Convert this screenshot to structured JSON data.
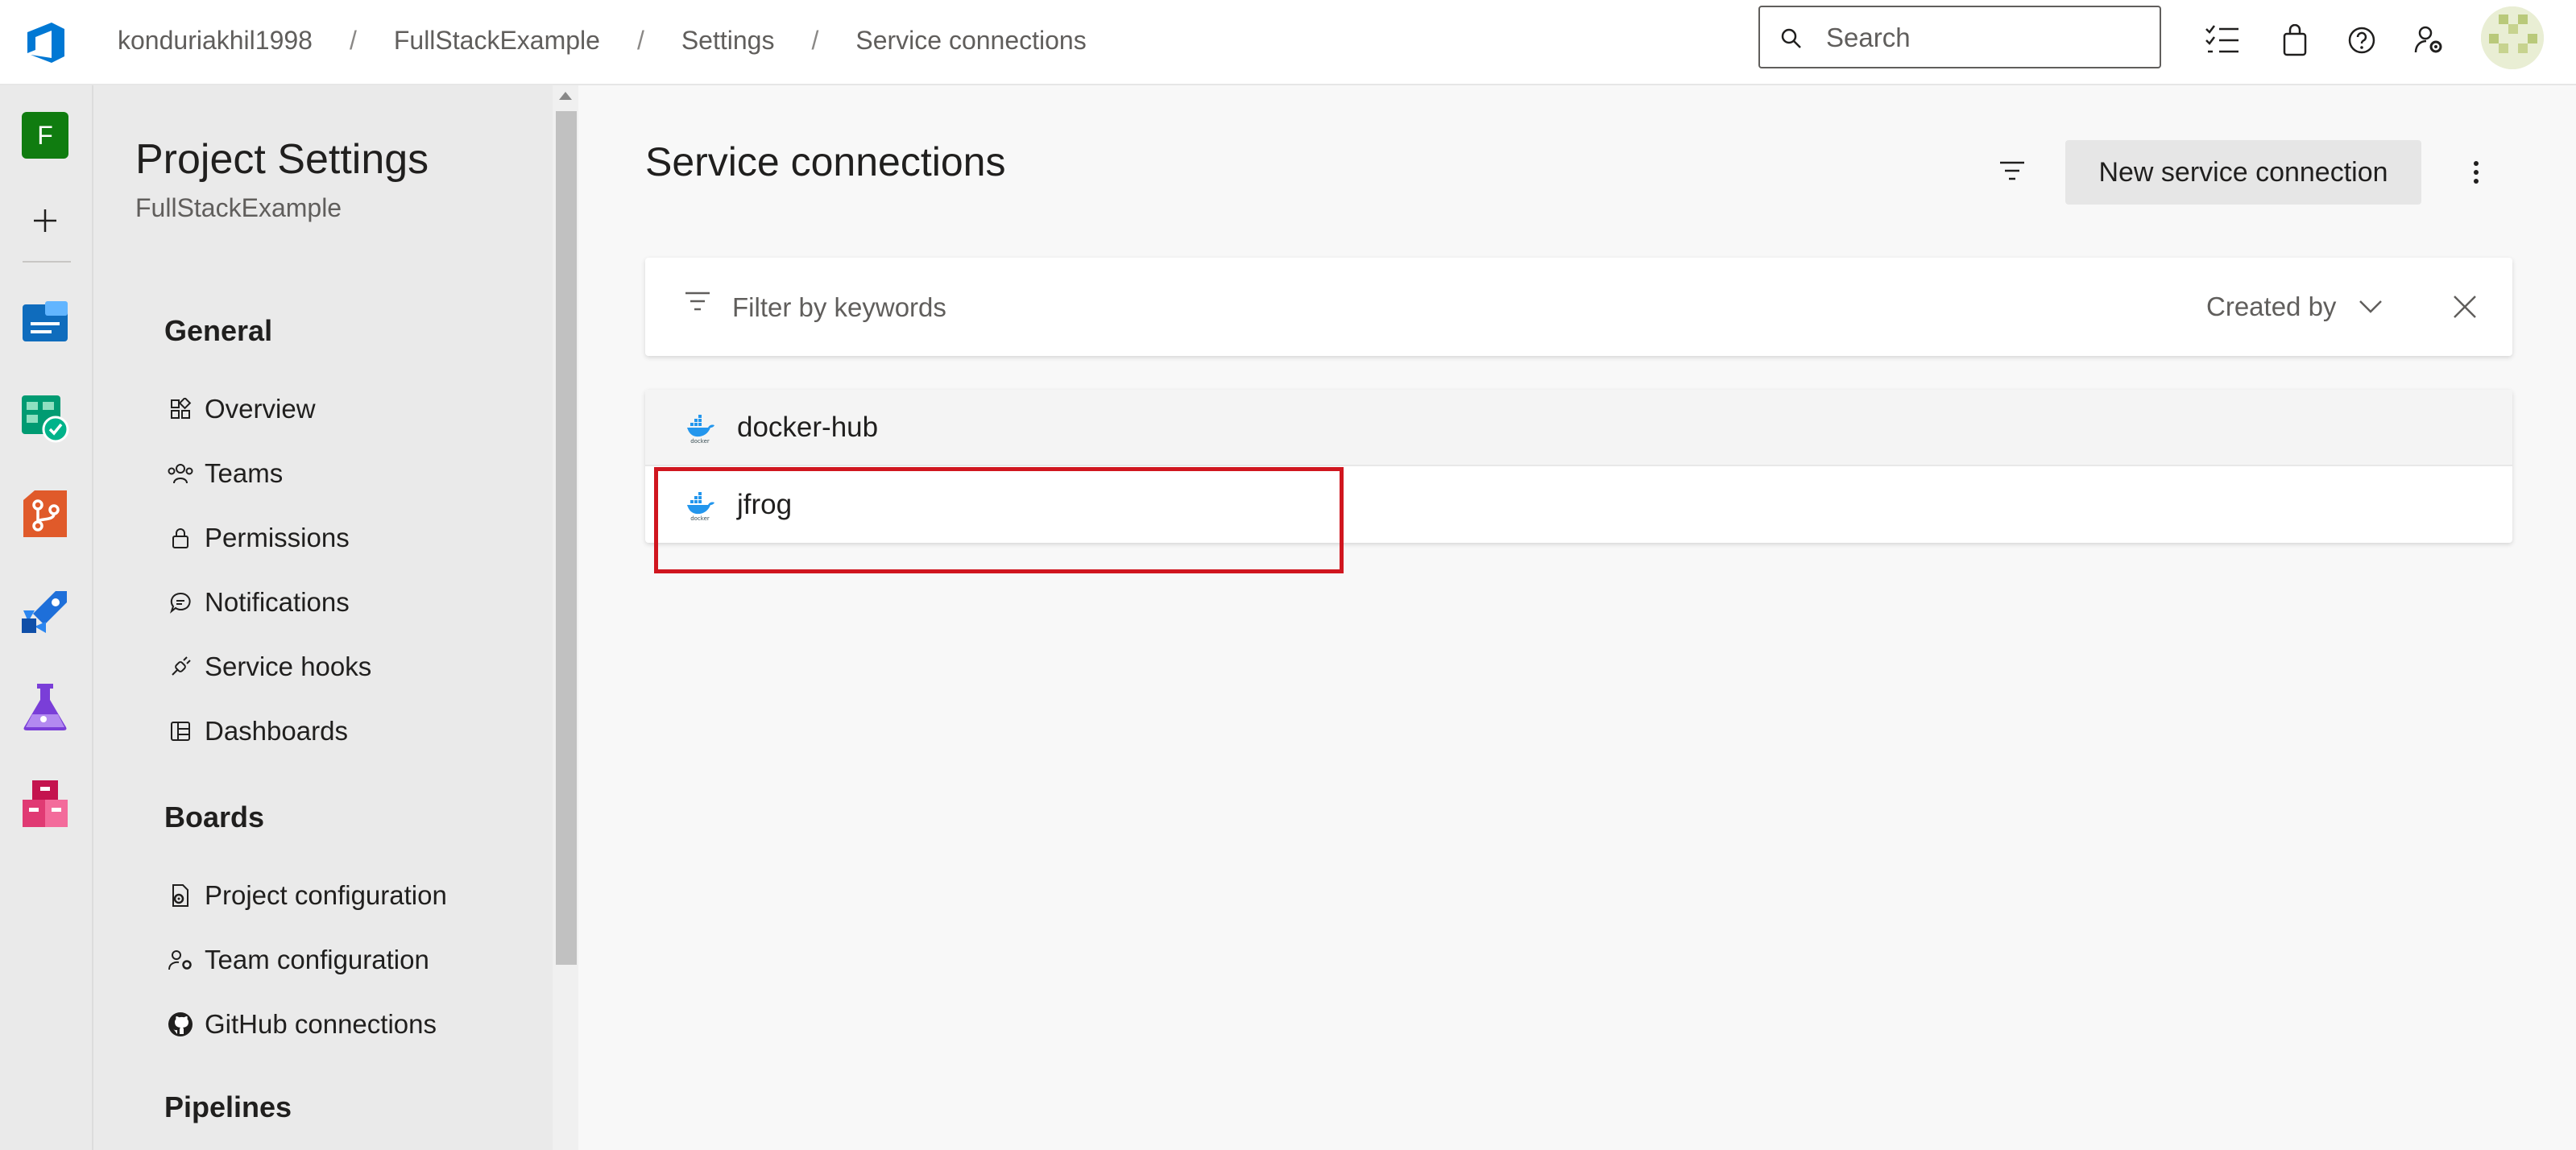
{
  "header": {
    "breadcrumbs": [
      "konduriakhil1998",
      "FullStackExample",
      "Settings",
      "Service connections"
    ],
    "search_placeholder": "Search"
  },
  "rail": {
    "project_initial": "F"
  },
  "settings_nav": {
    "title": "Project Settings",
    "subtitle": "FullStackExample",
    "groups": {
      "general": "General",
      "boards": "Boards",
      "pipelines": "Pipelines"
    },
    "general_items": [
      "Overview",
      "Teams",
      "Permissions",
      "Notifications",
      "Service hooks",
      "Dashboards"
    ],
    "boards_items": [
      "Project configuration",
      "Team configuration",
      "GitHub connections"
    ]
  },
  "main": {
    "title": "Service connections",
    "new_button_label": "New service connection",
    "filter": {
      "placeholder": "Filter by keywords",
      "created_by_label": "Created by"
    },
    "connections": [
      {
        "name": "docker-hub",
        "icon": "docker-icon"
      },
      {
        "name": "jfrog",
        "icon": "docker-icon"
      }
    ]
  },
  "colors": {
    "accent": "#0078d4",
    "highlight": "#d0161f",
    "project_badge": "#107c10"
  }
}
